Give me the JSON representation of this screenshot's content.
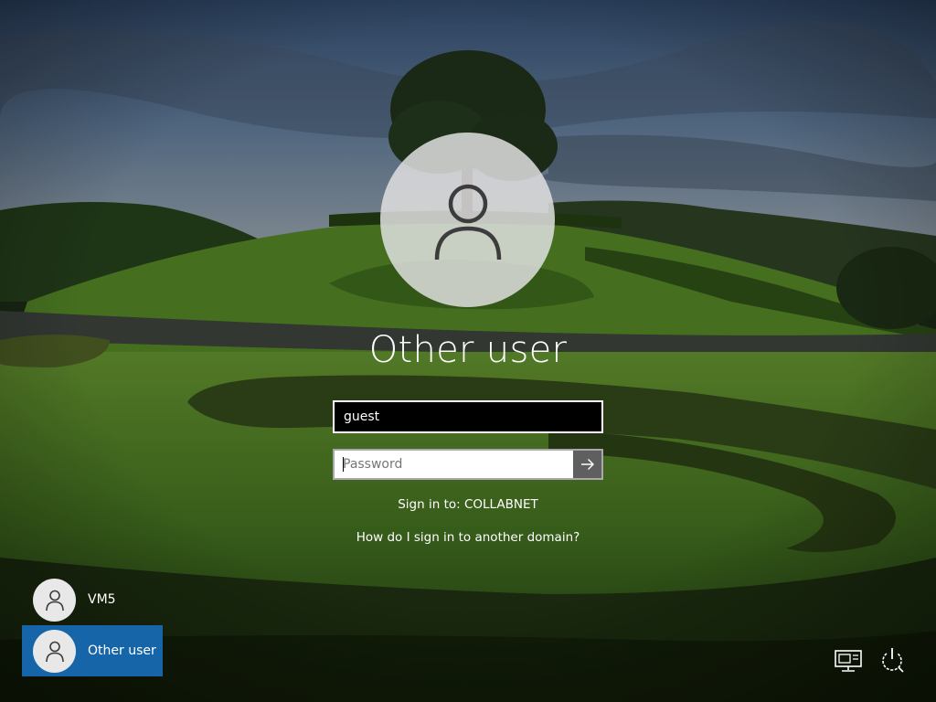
{
  "login": {
    "user_title": "Other user",
    "username_value": "guest",
    "password_placeholder": "Password",
    "signin_to": "Sign in to: COLLABNET",
    "domain_help_link": "How do I sign in to another domain?"
  },
  "user_list": [
    {
      "name": "VM5",
      "selected": false
    },
    {
      "name": "Other user",
      "selected": true
    }
  ],
  "tray": {
    "network_icon": "network-icon",
    "power_icon": "power-icon"
  },
  "colors": {
    "selected_tile": "#1565a8",
    "submit_button": "#5f5f5f"
  }
}
